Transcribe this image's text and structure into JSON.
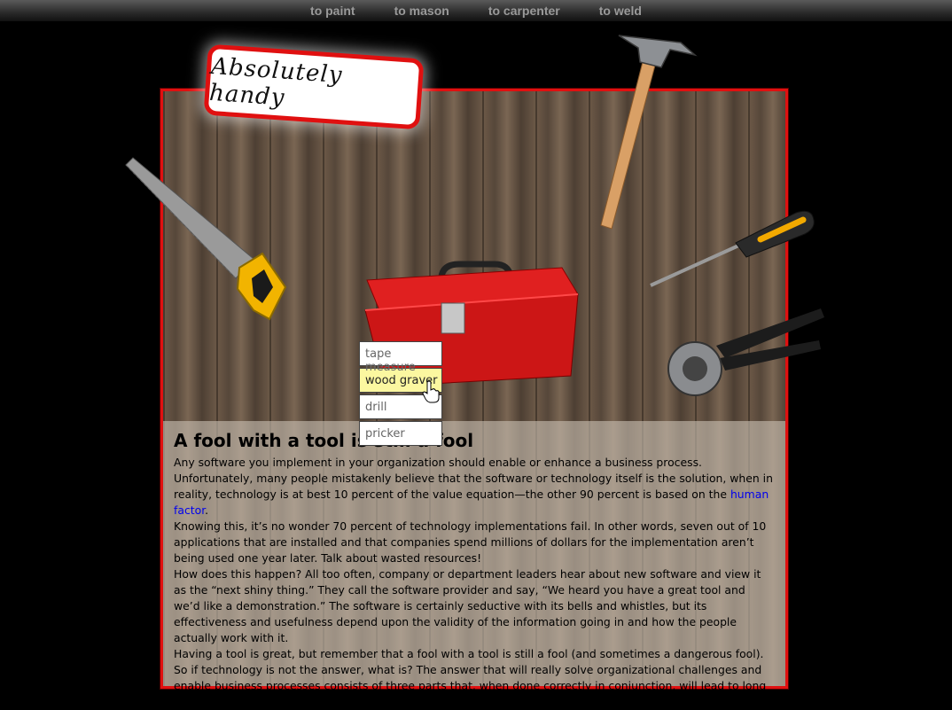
{
  "nav": {
    "items": [
      "to paint",
      "to mason",
      "to carpenter",
      "to weld"
    ]
  },
  "badge": {
    "text": "Absolutely handy"
  },
  "dropdown": {
    "items": [
      "tape measure",
      "wood graver",
      "drill",
      "pricker"
    ],
    "active": "wood graver"
  },
  "article": {
    "title": "A fool with a tool is still a fool",
    "p1_before": "Any software you implement in your organization should enable or enhance a business process. Unfortunately, many people mistakenly believe that the software or technology itself is the solution, when in reality, technology is at best 10 percent of the value equation—the other 90 percent is based on the ",
    "p1_link": "human factor",
    "p1_after": ".",
    "p2": "Knowing this, it’s no wonder 70 percent of technology implementations fail. In other words, seven out of 10 applications that are installed and that companies spend millions of dollars for the implementation aren’t being used one year later. Talk about wasted resources!",
    "p3": "How does this happen? All too often, company or department leaders hear about new software and view it as the “next shiny thing.” They call the software provider and say, “We heard you have a great tool and we’d like a demonstration.” The software is certainly seductive with its bells and whistles, but its effectiveness and usefulness depend upon the validity of the information going in and how the people actually work with it.",
    "p4": "Having a tool is great, but remember that a fool with a tool is still a fool (and sometimes a dangerous fool).",
    "p5": "So if technology is not the answer, what is? The answer that will really solve organizational challenges and enable business processes consists of three parts that, when done correctly in conjunction, will lead to long lasting results."
  },
  "colors": {
    "frame": "#e01010",
    "toolbox": "#d81c1c",
    "link": "#0000ee",
    "menu_active": "#fbf7a0"
  }
}
